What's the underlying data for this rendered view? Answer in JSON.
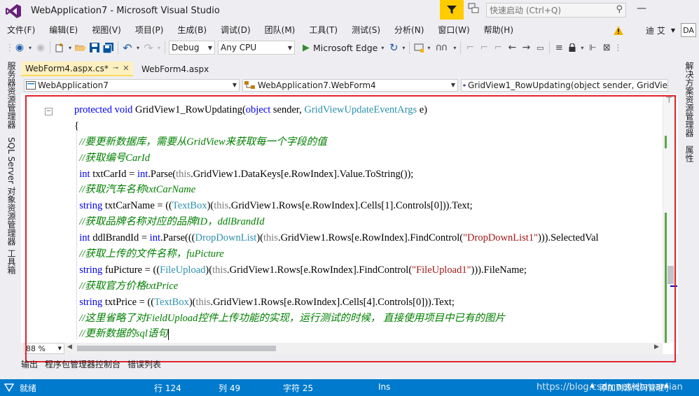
{
  "window": {
    "title": "WebApplication7 - Microsoft Visual Studio",
    "quick_launch_placeholder": "快速启动 (Ctrl+Q)",
    "minimize_glyph": "—"
  },
  "menu": {
    "items": [
      "文件(F)",
      "编辑(E)",
      "视图(V)",
      "项目(P)",
      "生成(B)",
      "调试(D)",
      "团队(M)",
      "工具(T)",
      "测试(S)",
      "分析(N)",
      "窗口(W)",
      "帮助(H)"
    ],
    "user": "迪 艾",
    "user_initials": "DA"
  },
  "toolbar": {
    "configuration": "Debug",
    "platform": "Any CPU",
    "run_target": "Microsoft Edge"
  },
  "side_panels": {
    "left": [
      "服务器资源管理器",
      "SQL Server 对象资源管理器",
      "工具箱"
    ],
    "right": [
      "解决方案资源管理器",
      "属性"
    ]
  },
  "tabs": [
    {
      "label": "WebForm4.aspx.cs*",
      "active": true
    },
    {
      "label": "WebForm4.aspx",
      "active": false
    }
  ],
  "navbar": {
    "project": "WebApplication7",
    "type": "WebApplication7.WebForm4",
    "member": "GridView1_RowUpdating(object sender, GridVie"
  },
  "code": {
    "lines": [
      [
        [
          "kw",
          "protected void "
        ],
        [
          "",
          "GridView1_RowUpdating("
        ],
        [
          "kw",
          "object"
        ],
        [
          "",
          " sender, "
        ],
        [
          "ty",
          "GridViewUpdateEventArgs"
        ],
        [
          "",
          " e)"
        ]
      ],
      [
        [
          "",
          "{"
        ]
      ],
      [
        [
          "",
          "  "
        ],
        [
          "cm",
          "//要更新数据库，需要从GridView来获取每一个字段的值"
        ]
      ],
      [
        [
          "",
          "  "
        ],
        [
          "cm",
          "//获取编号CarId"
        ]
      ],
      [
        [
          "",
          "  "
        ],
        [
          "kw",
          "int"
        ],
        [
          "",
          " txtCarId = "
        ],
        [
          "kw",
          "int"
        ],
        [
          "",
          ".Parse("
        ],
        [
          "gr",
          "this"
        ],
        [
          "",
          ".GridView1.DataKeys[e.RowIndex].Value.ToString());"
        ]
      ],
      [
        [
          "",
          "  "
        ],
        [
          "cm",
          "//获取汽车名称txtCarName"
        ]
      ],
      [
        [
          "",
          "  "
        ],
        [
          "kw",
          "string"
        ],
        [
          "",
          " txtCarName = (("
        ],
        [
          "ty",
          "TextBox"
        ],
        [
          "",
          ")("
        ],
        [
          "gr",
          "this"
        ],
        [
          "",
          ".GridView1.Rows[e.RowIndex].Cells[1].Controls[0])).Text;"
        ]
      ],
      [
        [
          "",
          "  "
        ],
        [
          "cm",
          "//获取品牌名称对应的品牌ID，ddlBrandId"
        ]
      ],
      [
        [
          "",
          "  "
        ],
        [
          "kw",
          "int"
        ],
        [
          "",
          " ddlBrandId = "
        ],
        [
          "kw",
          "int"
        ],
        [
          "",
          ".Parse((("
        ],
        [
          "ty",
          "DropDownList"
        ],
        [
          "",
          ")("
        ],
        [
          "gr",
          "this"
        ],
        [
          "",
          ".GridView1.Rows[e.RowIndex].FindControl("
        ],
        [
          "st",
          "\"DropDownList1\""
        ],
        [
          "",
          "))).SelectedVal"
        ]
      ],
      [
        [
          "",
          "  "
        ],
        [
          "cm",
          "//获取上传的文件名称，fuPicture"
        ]
      ],
      [
        [
          "",
          "  "
        ],
        [
          "kw",
          "string"
        ],
        [
          "",
          " fuPicture = (("
        ],
        [
          "ty",
          "FileUpload"
        ],
        [
          "",
          ")("
        ],
        [
          "gr",
          "this"
        ],
        [
          "",
          ".GridView1.Rows[e.RowIndex].FindControl("
        ],
        [
          "st",
          "\"FileUpload1\""
        ],
        [
          "",
          ")))"
        ],
        [
          "",
          ".FileName;"
        ]
      ],
      [
        [
          "",
          "  "
        ],
        [
          "cm",
          "//获取官方价格txtPrice"
        ]
      ],
      [
        [
          "",
          "  "
        ],
        [
          "kw",
          "string"
        ],
        [
          "",
          " txtPrice = (("
        ],
        [
          "ty",
          "TextBox"
        ],
        [
          "",
          ")("
        ],
        [
          "gr",
          "this"
        ],
        [
          "",
          ".GridView1.Rows[e.RowIndex].Cells[4].Controls[0])).Text;"
        ]
      ],
      [
        [
          "",
          "  "
        ],
        [
          "cm",
          "//这里省略了对FieldUpload控件上传功能的实现，运行测试的时候， 直接使用项目中已有的图片"
        ]
      ],
      [
        [
          "",
          "  "
        ],
        [
          "cm",
          "//更新数据的sql语句"
        ]
      ]
    ]
  },
  "editor": {
    "zoom": "88 %"
  },
  "bottom_tabs": [
    "输出",
    "程序包管理器控制台",
    "错误列表"
  ],
  "status": {
    "ready": "就绪",
    "line": "行 124",
    "col": "列 49",
    "char": "字符 25",
    "mode": "Ins",
    "watermark": "https://blog.csdn.net/dhruanjian",
    "source_control": "添加到源代码管理"
  },
  "colors": {
    "accent": "#007acc",
    "highlight_frame": "#e3222a",
    "active_tab": "#fff1bf"
  }
}
